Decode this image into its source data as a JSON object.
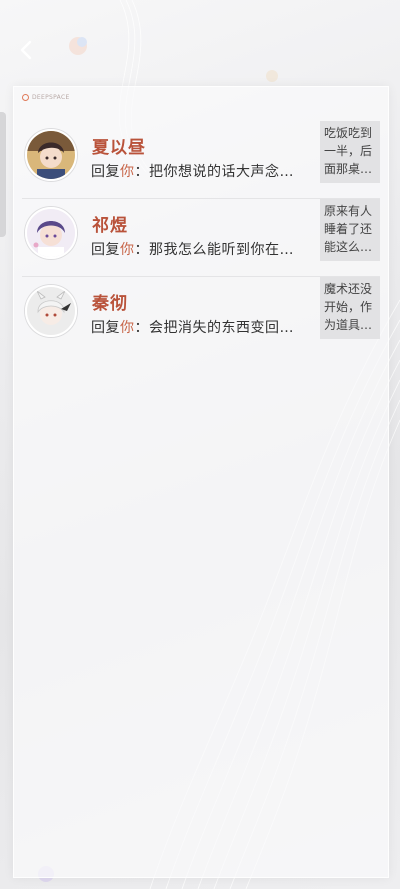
{
  "header": {
    "back_icon": "chevron-left-icon",
    "logo_text": "DEEPSPACE"
  },
  "messages": [
    {
      "name": "夏以昼",
      "reply_prefix": "回复",
      "reply_you": "你",
      "reply_text": "：把你想说的话大声念…",
      "preview": "吃饭吃到一半，后面那桌…",
      "avatar_icon": "character-avatar-icon"
    },
    {
      "name": "祁煜",
      "reply_prefix": "回复",
      "reply_you": "你",
      "reply_text": "：那我怎么能听到你在…",
      "preview": "原来有人睡着了还能这么…",
      "avatar_icon": "character-avatar-icon"
    },
    {
      "name": "秦彻",
      "reply_prefix": "回复",
      "reply_you": "你",
      "reply_text": "：会把消失的东西变回…",
      "preview": "魔术还没开始，作为道具…",
      "avatar_icon": "character-avatar-icon"
    }
  ],
  "colors": {
    "name": "#b9523a",
    "you_highlight": "#c8664a",
    "preview_bg": "#e2e2e4"
  }
}
